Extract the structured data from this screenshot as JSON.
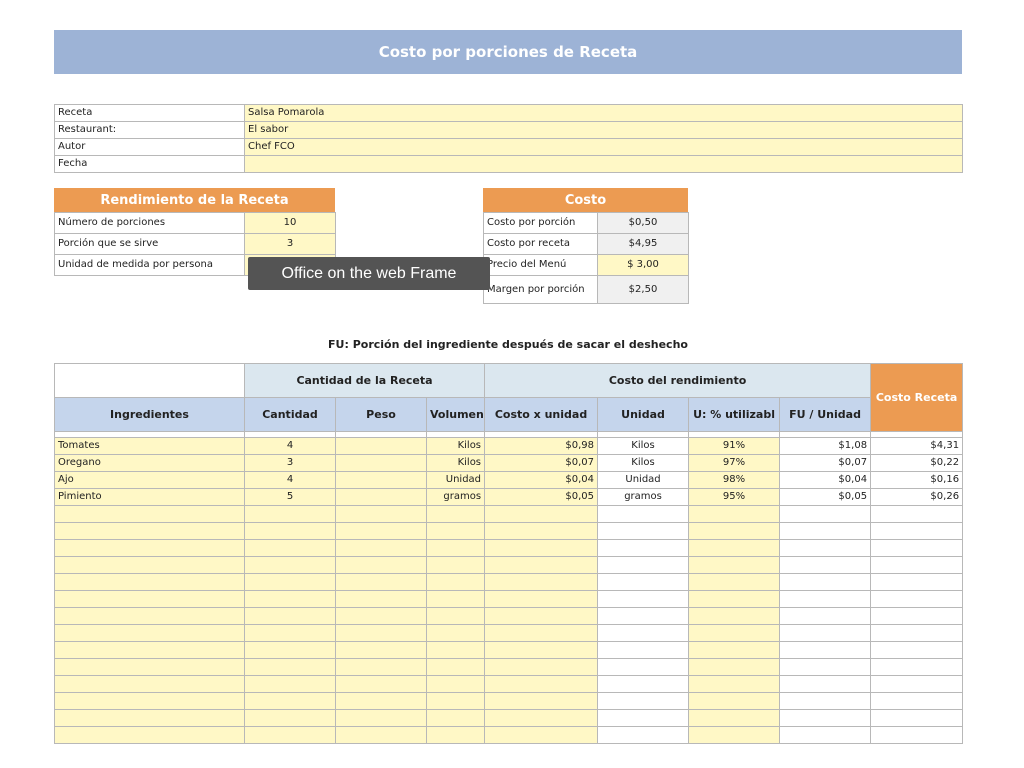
{
  "title": "Costo por porciones de Receta",
  "info": [
    {
      "label": "Receta",
      "value": "Salsa Pomarola"
    },
    {
      "label": "Restaurant:",
      "value": "El sabor"
    },
    {
      "label": "Autor",
      "value": "Chef FCO"
    },
    {
      "label": "Fecha",
      "value": ""
    }
  ],
  "rendimiento": {
    "header": "Rendimiento de la Receta",
    "rows": [
      {
        "label": "Número de porciones",
        "value": "10"
      },
      {
        "label": "Porción que se sirve",
        "value": "3"
      },
      {
        "label": "Unidad de medida por persona",
        "value": ""
      }
    ]
  },
  "costo": {
    "header": "Costo",
    "rows": [
      {
        "label": "Costo por porción",
        "value": "$0,50"
      },
      {
        "label": "Costo por receta",
        "value": "$4,95"
      },
      {
        "label": "Precio del Menú",
        "value": "$ 3,00"
      },
      {
        "label": "Margen por porción",
        "value": "$2,50"
      }
    ]
  },
  "tooltip": "Office on the web Frame",
  "fu_note": "FU: Porción del ingrediente después de sacar el deshecho",
  "table": {
    "group_headers": {
      "cantidad": "Cantidad de la Receta",
      "costo_rend": "Costo del rendimiento",
      "costo_receta": "Costo Receta"
    },
    "columns": [
      "Ingredientes",
      "Cantidad",
      "Peso",
      "Volumen",
      "Costo x unidad",
      "Unidad",
      "U: % utilizabl",
      "FU / Unidad"
    ],
    "rows": [
      [
        "Tomates",
        "4",
        "",
        "Kilos",
        "$0,98",
        "Kilos",
        "91%",
        "$1,08",
        "$4,31"
      ],
      [
        "Oregano",
        "3",
        "",
        "Kilos",
        "$0,07",
        "Kilos",
        "97%",
        "$0,07",
        "$0,22"
      ],
      [
        "Ajo",
        "4",
        "",
        "Unidad",
        "$0,04",
        "Unidad",
        "98%",
        "$0,04",
        "$0,16"
      ],
      [
        "Pimiento",
        "5",
        "",
        "gramos",
        "$0,05",
        "gramos",
        "95%",
        "$0,05",
        "$0,26"
      ]
    ],
    "empty_rows": 14
  },
  "colors": {
    "title_bg": "#9db3d6",
    "orange": "#ec9b52",
    "yellow": "#fff8c6",
    "header_blue": "#c5d5ec"
  }
}
